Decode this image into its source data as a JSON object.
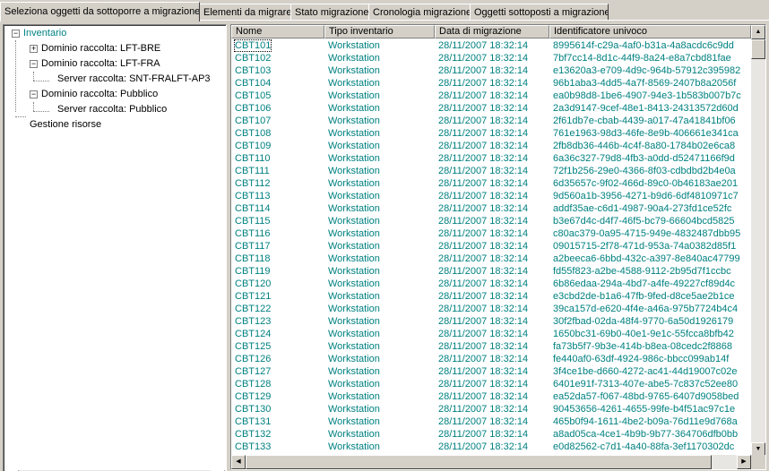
{
  "tabs": [
    {
      "label": "Seleziona oggetti da sottoporre a migrazione",
      "active": true
    },
    {
      "label": "Elementi da migrare",
      "active": false
    },
    {
      "label": "Stato migrazione",
      "active": false
    },
    {
      "label": "Cronologia migrazione",
      "active": false
    },
    {
      "label": "Oggetti sottoposti a migrazione",
      "active": false
    }
  ],
  "tree": {
    "inventory": "Inventario",
    "domain_bre": "Dominio raccolta: LFT-BRE",
    "domain_fra": "Dominio raccolta: LFT-FRA",
    "server_fra": "Server raccolta: SNT-FRALFT-AP3",
    "domain_pub": "Dominio raccolta: Pubblico",
    "server_pub": "Server raccolta: Pubblico",
    "resources": "Gestione risorse"
  },
  "grid": {
    "columns": [
      "Nome",
      "Tipo inventario",
      "Data di migrazione",
      "Identificatore univoco"
    ],
    "rows": [
      [
        "CBT101",
        "Workstation",
        "28/11/2007 18:32:14",
        "8995614f-c29a-4af0-b31a-4a8acdc6c9dd"
      ],
      [
        "CBT102",
        "Workstation",
        "28/11/2007 18:32:14",
        "7bf7cc14-8d1c-44f9-8a24-e8a7cbd81fae"
      ],
      [
        "CBT103",
        "Workstation",
        "28/11/2007 18:32:14",
        "e13620a3-e709-4d9c-964b-57912c395982"
      ],
      [
        "CBT104",
        "Workstation",
        "28/11/2007 18:32:14",
        "96b1aba3-4dd5-4a7f-8569-2407b8a2056f"
      ],
      [
        "CBT105",
        "Workstation",
        "28/11/2007 18:32:14",
        "ea0b98d8-1be6-4907-94e3-1b583b007b7c"
      ],
      [
        "CBT106",
        "Workstation",
        "28/11/2007 18:32:14",
        "2a3d9147-9cef-48e1-8413-24313572d60d"
      ],
      [
        "CBT107",
        "Workstation",
        "28/11/2007 18:32:14",
        "2f61db7e-cbab-4439-a017-47a41841bf06"
      ],
      [
        "CBT108",
        "Workstation",
        "28/11/2007 18:32:14",
        "761e1963-98d3-46fe-8e9b-406661e341ca"
      ],
      [
        "CBT109",
        "Workstation",
        "28/11/2007 18:32:14",
        "2fb8db36-446b-4c4f-8a80-1784b02e6ca8"
      ],
      [
        "CBT110",
        "Workstation",
        "28/11/2007 18:32:14",
        "6a36c327-79d8-4fb3-a0dd-d52471166f9d"
      ],
      [
        "CBT111",
        "Workstation",
        "28/11/2007 18:32:14",
        "72f1b256-29e0-4366-8f03-cdbdbd2b4e0a"
      ],
      [
        "CBT112",
        "Workstation",
        "28/11/2007 18:32:14",
        "6d35657c-9f02-466d-89c0-0b46183ae201"
      ],
      [
        "CBT113",
        "Workstation",
        "28/11/2007 18:32:14",
        "9d560a1b-3956-4271-b9d6-6df4810971c7"
      ],
      [
        "CBT114",
        "Workstation",
        "28/11/2007 18:32:14",
        "addf35ae-c6d1-4987-90a4-273fd1ce52fc"
      ],
      [
        "CBT115",
        "Workstation",
        "28/11/2007 18:32:14",
        "b3e67d4c-d4f7-46f5-bc79-66604bcd5825"
      ],
      [
        "CBT116",
        "Workstation",
        "28/11/2007 18:32:14",
        "c80ac379-0a95-4715-949e-4832487dbb95"
      ],
      [
        "CBT117",
        "Workstation",
        "28/11/2007 18:32:14",
        "09015715-2f78-471d-953a-74a0382d85f1"
      ],
      [
        "CBT118",
        "Workstation",
        "28/11/2007 18:32:14",
        "a2beeca6-6bbd-432c-a397-8e840ac47799"
      ],
      [
        "CBT119",
        "Workstation",
        "28/11/2007 18:32:14",
        "fd55f823-a2be-4588-9112-2b95d7f1ccbc"
      ],
      [
        "CBT120",
        "Workstation",
        "28/11/2007 18:32:14",
        "6b86edaa-294a-4bd7-a4fe-49227cf89d4c"
      ],
      [
        "CBT121",
        "Workstation",
        "28/11/2007 18:32:14",
        "e3cbd2de-b1a6-47fb-9fed-d8ce5ae2b1ce"
      ],
      [
        "CBT122",
        "Workstation",
        "28/11/2007 18:32:14",
        "39ca157d-e620-4f4e-a46a-975b7724b4c4"
      ],
      [
        "CBT123",
        "Workstation",
        "28/11/2007 18:32:14",
        "30f2fbad-02da-48f4-9770-6a50d1926179"
      ],
      [
        "CBT124",
        "Workstation",
        "28/11/2007 18:32:14",
        "1650bc31-69b0-40e1-9e1c-55fcca8bfb42"
      ],
      [
        "CBT125",
        "Workstation",
        "28/11/2007 18:32:14",
        "fa73b5f7-9b3e-414b-b8ea-08cedc2f8868"
      ],
      [
        "CBT126",
        "Workstation",
        "28/11/2007 18:32:14",
        "fe440af0-63df-4924-986c-bbcc099ab14f"
      ],
      [
        "CBT127",
        "Workstation",
        "28/11/2007 18:32:14",
        "3f4ce1be-d660-4272-ac41-44d19007c02e"
      ],
      [
        "CBT128",
        "Workstation",
        "28/11/2007 18:32:14",
        "6401e91f-7313-407e-abe5-7c837c52ee80"
      ],
      [
        "CBT129",
        "Workstation",
        "28/11/2007 18:32:14",
        "ea52da57-f067-48bd-9765-6407d9058bed"
      ],
      [
        "CBT130",
        "Workstation",
        "28/11/2007 18:32:14",
        "90453656-4261-4655-99fe-b4f51ac97c1e"
      ],
      [
        "CBT131",
        "Workstation",
        "28/11/2007 18:32:14",
        "465b0f94-1611-4be2-b09a-76d11e9d768a"
      ],
      [
        "CBT132",
        "Workstation",
        "28/11/2007 18:32:14",
        "a8ad05ca-4ce1-4b9b-9b77-364706dfb0bb"
      ],
      [
        "CBT133",
        "Workstation",
        "28/11/2007 18:32:14",
        "e0d82562-c7d1-4a40-88fa-3ef1170302dc"
      ]
    ],
    "selected_index": 0,
    "vscroll_position": 0.0
  },
  "colors": {
    "row_text": "#008080",
    "tree_selected": "#008080",
    "window_bg": "#d4d0c8"
  }
}
